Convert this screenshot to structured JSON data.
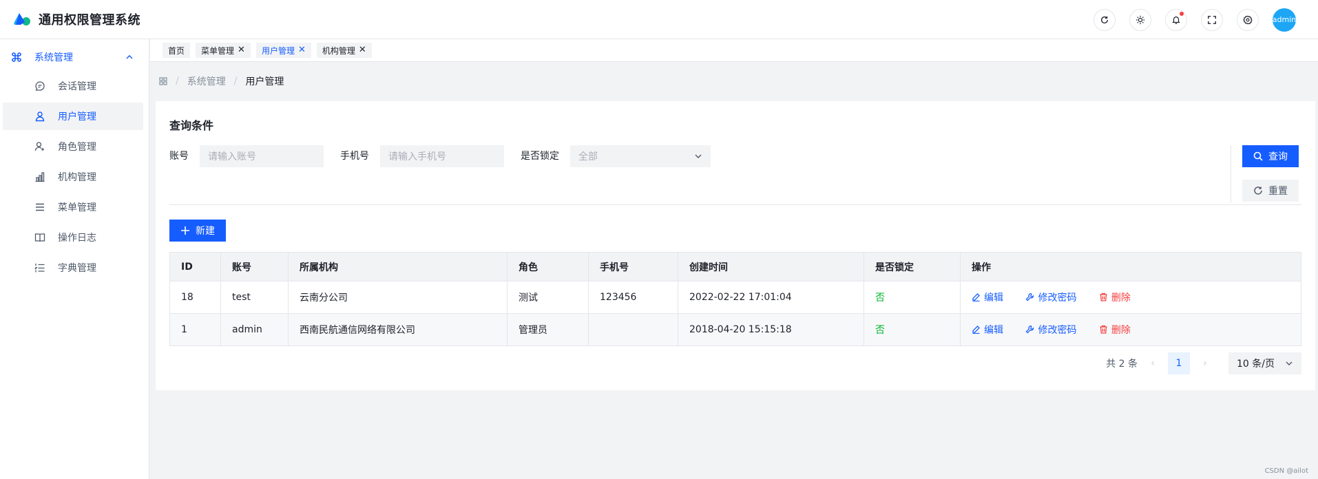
{
  "app": {
    "title": "通用权限管理系统"
  },
  "header": {
    "tools": [
      {
        "icon": "refresh-icon"
      },
      {
        "icon": "sun-icon"
      },
      {
        "icon": "bell-icon",
        "badge": true
      },
      {
        "icon": "fullscreen-icon"
      },
      {
        "icon": "settings-icon"
      }
    ],
    "avatar_label": "admin"
  },
  "sidebar": {
    "group_label": "系统管理",
    "items": [
      {
        "label": "会话管理",
        "icon": "chat-icon",
        "active": false
      },
      {
        "label": "用户管理",
        "icon": "user-icon",
        "active": true
      },
      {
        "label": "角色管理",
        "icon": "user-add-icon",
        "active": false
      },
      {
        "label": "机构管理",
        "icon": "bar-chart-icon",
        "active": false
      },
      {
        "label": "菜单管理",
        "icon": "menu-icon",
        "active": false
      },
      {
        "label": "操作日志",
        "icon": "book-icon",
        "active": false
      },
      {
        "label": "字典管理",
        "icon": "list-icon",
        "active": false
      }
    ]
  },
  "tabs": [
    {
      "label": "首页",
      "closable": false,
      "active": false
    },
    {
      "label": "菜单管理",
      "closable": true,
      "active": false
    },
    {
      "label": "用户管理",
      "closable": true,
      "active": true
    },
    {
      "label": "机构管理",
      "closable": true,
      "active": false
    }
  ],
  "breadcrumb": {
    "root": "系统管理",
    "current": "用户管理"
  },
  "query": {
    "title": "查询条件",
    "account_label": "账号",
    "account_placeholder": "请输入账号",
    "phone_label": "手机号",
    "phone_placeholder": "请输入手机号",
    "locked_label": "是否锁定",
    "locked_value": "全部",
    "search_button": "查询",
    "reset_button": "重置"
  },
  "new_button": "新建",
  "table": {
    "columns": [
      "ID",
      "账号",
      "所属机构",
      "角色",
      "手机号",
      "创建时间",
      "是否锁定",
      "操作"
    ],
    "rows": [
      {
        "id": "18",
        "account": "test",
        "org": "云南分公司",
        "role": "测试",
        "phone": "123456",
        "created": "2022-02-22 17:01:04",
        "locked": "否"
      },
      {
        "id": "1",
        "account": "admin",
        "org": "西南民航通信网络有限公司",
        "role": "管理员",
        "phone": "",
        "created": "2018-04-20 15:15:18",
        "locked": "否"
      }
    ],
    "actions": {
      "edit": "编辑",
      "password": "修改密码",
      "delete": "删除"
    }
  },
  "pagination": {
    "total_text": "共 2 条",
    "current_page": "1",
    "page_size": "10 条/页"
  },
  "watermark": "CSDN @ailot",
  "colors": {
    "primary": "#165dff",
    "success": "#00b42a",
    "danger": "#f53f3f"
  }
}
